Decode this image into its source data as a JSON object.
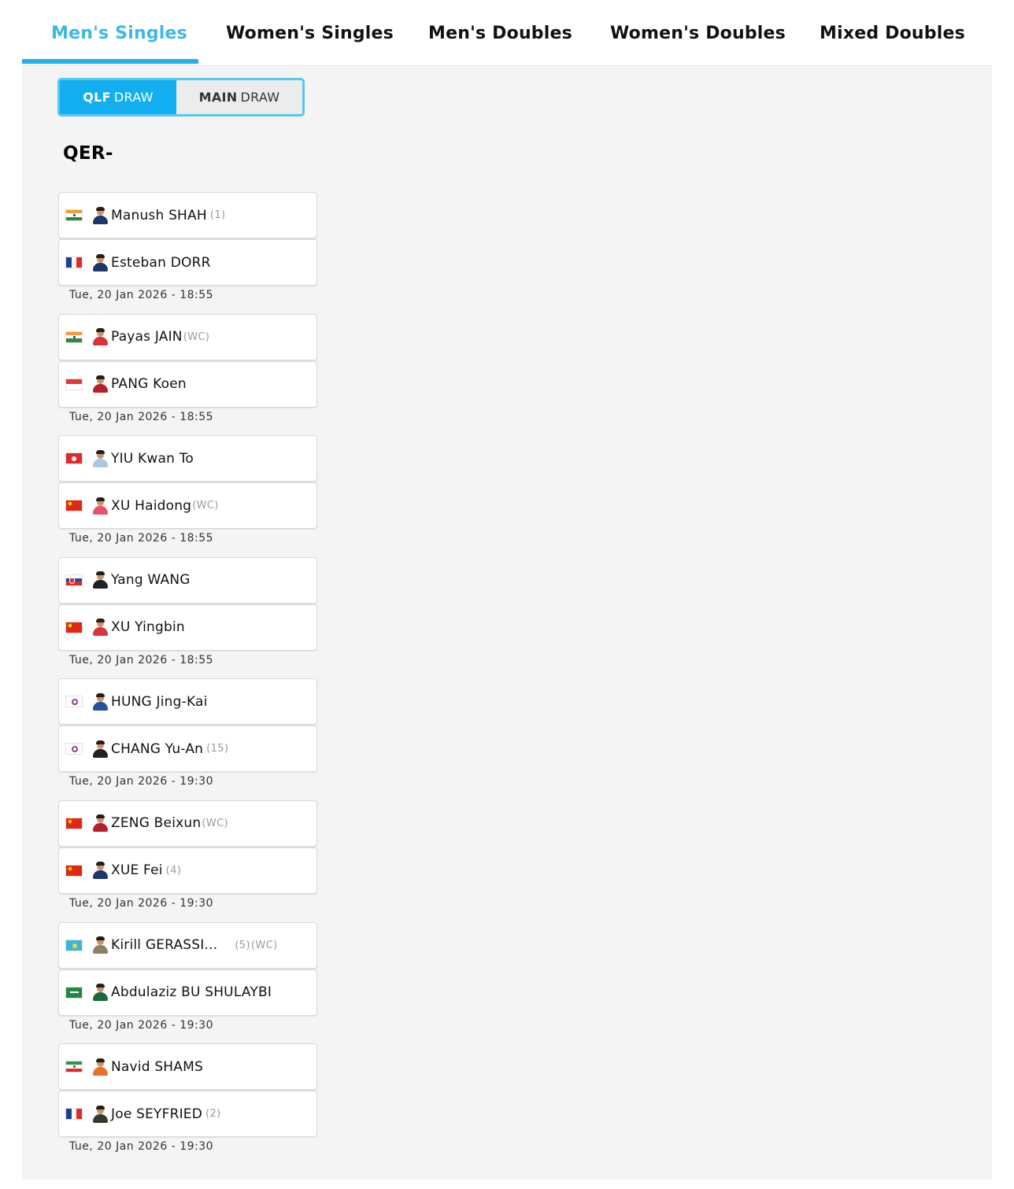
{
  "tabs": [
    {
      "label": "Men's Singles",
      "active": true
    },
    {
      "label": "Women's Singles",
      "active": false
    },
    {
      "label": "Men's Doubles",
      "active": false
    },
    {
      "label": "Women's Doubles",
      "active": false
    },
    {
      "label": "Mixed Doubles",
      "active": false
    }
  ],
  "draw_toggle": {
    "qlf_bold": "QLF",
    "qlf_rest": "DRAW",
    "main_bold": "MAIN",
    "main_rest": "DRAW",
    "selected": "QLF DRAW"
  },
  "round_title": "QER-",
  "colors": {
    "accent": "#1fb3ec",
    "active_tab_text": "#3cb8e8",
    "panel_bg": "#f4f4f4"
  },
  "matches": [
    {
      "p1": {
        "name": "Manush SHAH",
        "seed": "(1)",
        "flag": "india-flag"
      },
      "p2": {
        "name": "Esteban DORR",
        "seed": "",
        "flag": "france-flag"
      },
      "time": "Tue, 20 Jan 2026 - 18:55"
    },
    {
      "p1": {
        "name": "Payas JAIN",
        "seed": "(WC)",
        "flag": "india-flag"
      },
      "p2": {
        "name": "PANG Koen",
        "seed": "",
        "flag": "singapore-flag"
      },
      "time": "Tue, 20 Jan 2026 - 18:55"
    },
    {
      "p1": {
        "name": "YIU Kwan To",
        "seed": "",
        "flag": "hong-kong-flag"
      },
      "p2": {
        "name": "XU Haidong",
        "seed": "(WC)",
        "flag": "china-flag"
      },
      "time": "Tue, 20 Jan 2026 - 18:55"
    },
    {
      "p1": {
        "name": "Yang WANG",
        "seed": "",
        "flag": "slovakia-flag"
      },
      "p2": {
        "name": "XU Yingbin",
        "seed": "",
        "flag": "china-flag"
      },
      "time": "Tue, 20 Jan 2026 - 18:55"
    },
    {
      "p1": {
        "name": "HUNG Jing-Kai",
        "seed": "",
        "flag": "chinese-taipei-flag"
      },
      "p2": {
        "name": "CHANG Yu-An",
        "seed": "(15)",
        "flag": "chinese-taipei-flag"
      },
      "time": "Tue, 20 Jan 2026 - 19:30"
    },
    {
      "p1": {
        "name": "ZENG Beixun",
        "seed": "(WC)",
        "flag": "china-flag"
      },
      "p2": {
        "name": "XUE Fei",
        "seed": "(4)",
        "flag": "china-flag"
      },
      "time": "Tue, 20 Jan 2026 - 19:30"
    },
    {
      "p1": {
        "name": "Kirill GERASSI...",
        "seed": "(5)",
        "seed2": "(WC)",
        "flag": "kazakhstan-flag"
      },
      "p2": {
        "name": "Abdulaziz BU SHULAYBI",
        "seed": "",
        "flag": "saudi-arabia-flag"
      },
      "time": "Tue, 20 Jan 2026 - 19:30"
    },
    {
      "p1": {
        "name": "Navid SHAMS",
        "seed": "",
        "flag": "iran-flag"
      },
      "p2": {
        "name": "Joe SEYFRIED",
        "seed": "(2)",
        "flag": "france-flag"
      },
      "time": "Tue, 20 Jan 2026 - 19:30"
    }
  ]
}
